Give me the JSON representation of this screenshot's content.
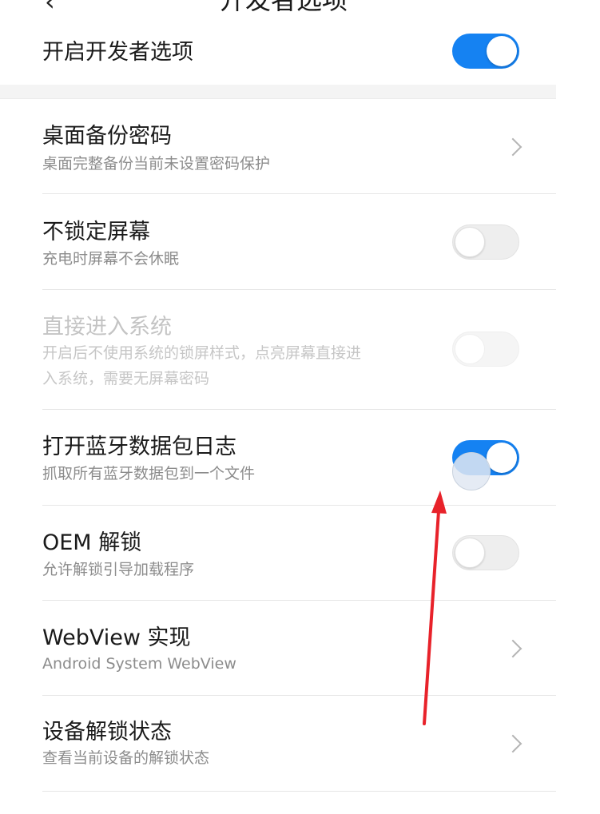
{
  "header": {
    "back_icon": "‹",
    "title": "开发者选项"
  },
  "rows": {
    "developer_options": {
      "title": "开启开发者选项",
      "toggle": "on"
    },
    "desktop_backup_password": {
      "title": "桌面备份密码",
      "subtitle": "桌面完整备份当前未设置密码保护",
      "icon": "chevron-right-icon"
    },
    "stay_awake": {
      "title": "不锁定屏幕",
      "subtitle": "充电时屏幕不会休眠",
      "toggle": "off"
    },
    "direct_enter_system": {
      "title": "直接进入系统",
      "subtitle_line1": "开启后不使用系统的锁屏样式，点亮屏幕直接进",
      "subtitle_line2": "入系统，需要无屏幕密码",
      "toggle": "off",
      "enabled": false
    },
    "bluetooth_hci_log": {
      "title": "打开蓝牙数据包日志",
      "subtitle": "抓取所有蓝牙数据包到一个文件",
      "toggle": "on"
    },
    "oem_unlock": {
      "title": "OEM 解锁",
      "subtitle": "允许解锁引导加载程序",
      "toggle": "off"
    },
    "webview": {
      "title": "WebView 实现",
      "subtitle": "Android System WebView",
      "icon": "chevron-right-icon"
    },
    "device_unlock_status": {
      "title": "设备解锁状态",
      "subtitle": "查看当前设备的解锁状态",
      "icon": "chevron-right-icon"
    }
  },
  "colors": {
    "accent": "#1582f2",
    "annotation_arrow": "#e8222a",
    "text_primary": "#1a1a1a",
    "text_secondary": "#8c8c8c"
  }
}
